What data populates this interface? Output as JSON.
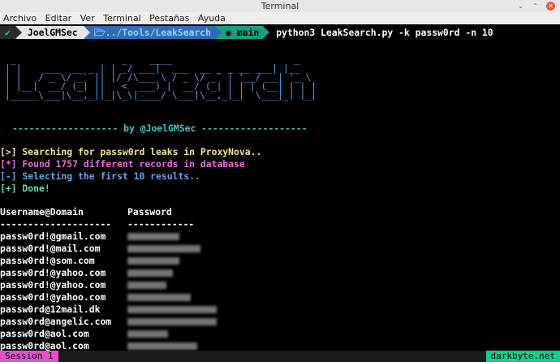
{
  "window": {
    "title": "Terminal"
  },
  "menu": [
    "Archivo",
    "Editar",
    "Ver",
    "Terminal",
    "Pestañas",
    "Ayuda"
  ],
  "prompt": {
    "user": "JoelGMSec",
    "path": "../Tools/LeakSearch",
    "branch": "main",
    "command": "python3 LeakSearch.py -k passw0rd -n 10"
  },
  "banner": {
    "ascii": " _                   _    ____                      _\n| |    ___  __ _ | | _/ ___|  ___  __ _ _ __ ___| |__\n| |   / _ \\/ _` || |/ /\\___ \\ / _ \\/ _` | '__/ __| '_ \\\n| |__|  __/ (_| ||   <  ___) |  __/ (_| | | | (__| | | |\n|_____\\___|\\__,_||_|\\_\\|____/ \\___|\\__,_|_|  \\___|_| |_|",
    "byline": "------------------- by @JoelGMSec -------------------"
  },
  "log": [
    {
      "text": "[>] Searching for passw0rd leaks in ProxyNova..",
      "color": "#f5e68c"
    },
    {
      "text": "[*] Found 1757 different records in database",
      "color": "#e86be0"
    },
    {
      "text": "[-] Selecting the first 10 results..",
      "color": "#5ba8f0"
    },
    {
      "text": "[+] Done!",
      "color": "#5fe0b0"
    }
  ],
  "results": {
    "headers": [
      "Username@Domain",
      "Password"
    ],
    "separator": [
      "--------------------",
      "------------"
    ],
    "rows": [
      "passw0rd!@gmail.com",
      "passw0rd!@mail.com",
      "passw0rd!@som.com",
      "passw0rd!@yahoo.com",
      "passw0rd!@yahoo.com",
      "passw0rd!@yahoo.com",
      "passw0rd@12mail.dk",
      "passw0rd@angelic.com",
      "passw0rd@aol.com",
      "passw0rd@aol.com"
    ]
  },
  "statusbar": {
    "session": "Session 1",
    "watermark": "darkbyte.net"
  }
}
